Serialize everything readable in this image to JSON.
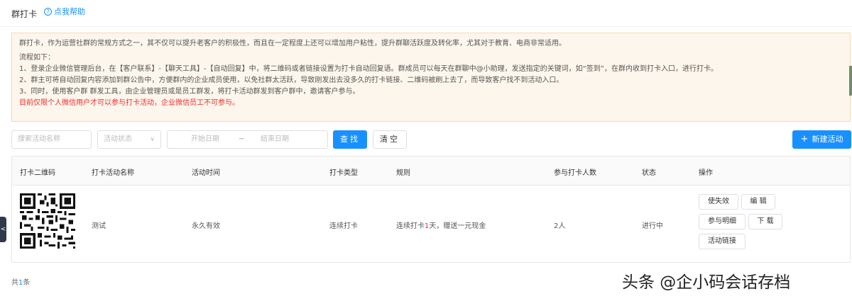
{
  "header": {
    "title": "群打卡",
    "help_label": "点我帮助",
    "help_icon": "?"
  },
  "notice": {
    "intro": "群打卡，作为运营社群的常规方式之一，其不仅可以提升老客户的积极性，而且在一定程度上还可以增加用户粘性，提升群聊活跃度及转化率，尤其对于教育、电商非常适用。",
    "flow_title": "流程如下：",
    "step1": "1、登录企业微信管理后台，在【客户联系】-【聊天工具】-【自动回复】中，将二维码或者链接设置为打卡自动回复语。群成员可以每天在群聊中@小助理，发送指定的关键词，如“签到”，在群内收到打卡入口，进行打卡。",
    "step2": "2、群主可将自动回复内容添加到群公告中，方便群内的企业成员使用，以免社群太活跃，导致刚发出去没多久的打卡链接、二维码被刷上去了，而导致客户找不到活动入口。",
    "step3": "3、同时，使用客户群 群发工具，由企业管理员或是员工群发，将打卡活动群发到客户群中，邀请客户参与。",
    "warning": "目前仅限个人微信用户才可以参与打卡活动，企业微信员工不可参与。"
  },
  "filters": {
    "name_placeholder": "搜索活动名称",
    "status_placeholder": "活动状态",
    "start_date_placeholder": "开始日期",
    "date_separator": "~",
    "end_date_placeholder": "结束日期",
    "search_label": "查找",
    "clear_label": "清空",
    "new_label": "新建活动"
  },
  "table": {
    "headers": {
      "qr": "打卡二维码",
      "name": "打卡活动名称",
      "time": "活动时间",
      "type": "打卡类型",
      "rule": "规则",
      "count": "参与打卡人数",
      "status": "状态",
      "ops": "操作"
    },
    "rows": [
      {
        "name": "测试",
        "time": "永久有效",
        "type": "连续打卡",
        "rule_prefix": "连续打卡",
        "rule_days": "1",
        "rule_suffix": "天，赠送一元现金",
        "count": "2人",
        "status": "进行中",
        "ops": {
          "disable": "使失效",
          "edit": "编 辑",
          "details": "参与明细",
          "download": "下 载",
          "link": "活动链接"
        }
      }
    ]
  },
  "footer": {
    "total_prefix": "共",
    "total_count": "1",
    "total_suffix": "条"
  },
  "sidebar_toggle": "<",
  "watermark": "头条 @企小码会话存档",
  "colors": {
    "primary": "#1890ff",
    "warning_text": "#f02b2b",
    "notice_bg": "#fdf6ec"
  }
}
